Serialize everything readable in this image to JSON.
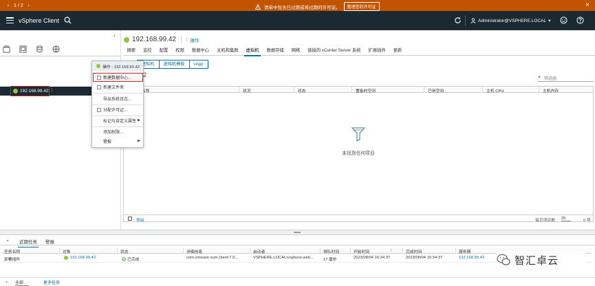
{
  "banner": {
    "pager": "1 / 2",
    "message": "清单中包含已过期或将过期的许可证。",
    "action": "管理您的许可证",
    "close": "×"
  },
  "header": {
    "brand": "vSphere Client",
    "user": "Administrator@VSPHERE.LOCAL",
    "user_caret": "▾"
  },
  "tree": {
    "host": "192.168.99.42",
    "marker1": "1"
  },
  "context_menu": {
    "header": "操作 - 192.168.99.42",
    "items": [
      "新建数据中心...",
      "新建文件夹",
      "导出系统日志...",
      "分配许可证...",
      "标记与自定义属性",
      "添加权限...",
      "警报"
    ],
    "marker2": "2"
  },
  "main": {
    "title": "192.168.99.42",
    "actions_label": "操作",
    "tabs": [
      "摘要",
      "监控",
      "配置",
      "权限",
      "数据中心",
      "主机和集群",
      "虚拟机",
      "数据存储",
      "网络",
      "链接的 vCenter Server 系统",
      "扩展插件",
      "更新"
    ],
    "active_tab": "虚拟机",
    "subtabs": [
      "虚拟机",
      "虚拟机模板",
      "vApp"
    ],
    "filter_placeholder": "筛选器",
    "grid_headers": [
      "名称",
      "状况",
      "状态",
      "置备的空间",
      "已用空间",
      "主机 CPU",
      "主机内存"
    ],
    "empty_text": "未找到任何项目",
    "export": "导出",
    "items_per_page_label": "每页项目数",
    "items_per_page": "35",
    "count": "0 项"
  },
  "tasks": {
    "tabs": [
      "近期任务",
      "警报"
    ],
    "headers": [
      "任务名称",
      "对象",
      "状态",
      "详细信息",
      "启动者",
      "排队时间",
      "开始时间",
      "完成时间",
      "服务器"
    ],
    "sort_arrow": "↓",
    "row": {
      "task": "部署插件",
      "object": "192.168.99.42",
      "status": "已完成",
      "details": "com.vmware.vum.client:7.0...",
      "initiator": "VSPHERE.LOCAL\\vsphere-web...",
      "queued": "17 毫秒",
      "start": "2023/08/04 16:34:37",
      "end": "2023/08/04 16:34:37",
      "server": "192.168.99.42"
    },
    "filter_value": "全部",
    "more": "更多任务"
  },
  "watermark": "智汇卓云",
  "colors": {
    "banner": "#c25400",
    "header": "#1b2a32",
    "link": "#0072a3",
    "highlight": "#e02020",
    "host_icon": "#8ec641"
  }
}
